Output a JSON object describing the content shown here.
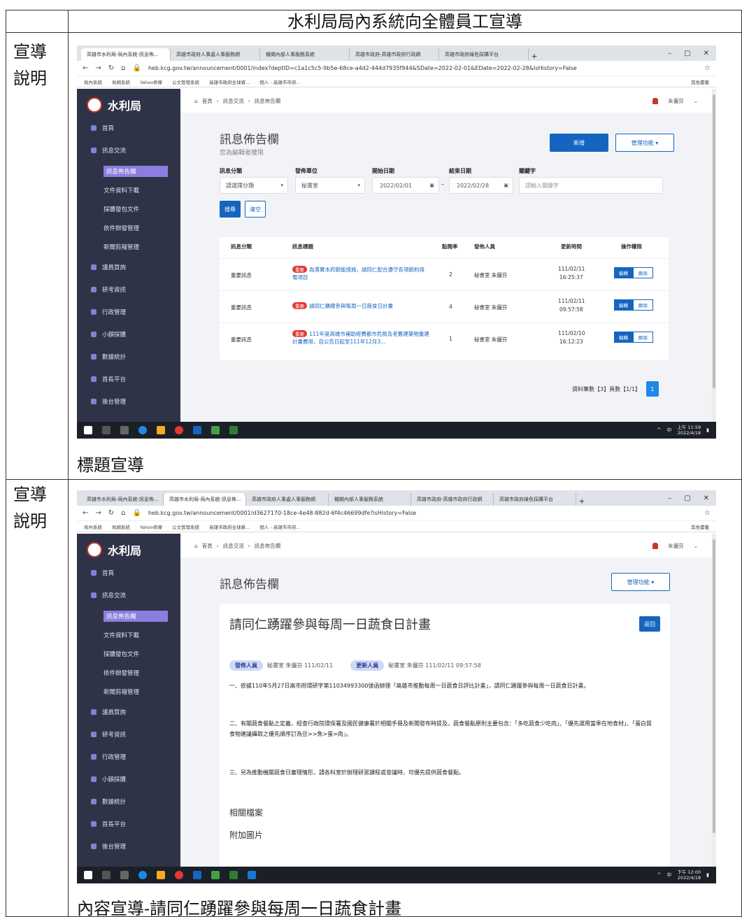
{
  "document": {
    "title": "水利局局內系統向全體員工宣導",
    "row_label": "宣導說明",
    "caption_1": "標題宣導",
    "caption_2": "內容宣導-請同仁踴躍參與每周一日蔬食計畫"
  },
  "browser_1": {
    "tabs": [
      "高雄市水利局-局內系統-訊息佈...",
      "高雄市政府人事處人事服務網",
      "機關內部人事服務系統",
      "高雄市政府-高雄市政府行政網",
      "高雄市政府綠色採購平台"
    ],
    "url": "heb.kcg.gov.tw/announcement/0001/index?deptID=c1a1c5c5-9b5e-68ce-a4d2-444d7935f944&SDate=2022-02-01&EDate=2022-02-28&IsHistory=False",
    "bookmarks": [
      "局內系統",
      "局網系統",
      "Yahoo奇摩",
      "公文管理系統",
      "高雄市政府全球資...",
      "個人 - 高雄市市府..."
    ],
    "bookmarks_right": "其他書籤"
  },
  "browser_2": {
    "tabs": [
      "高雄市水利局-局內系統-訊息佈...",
      "高雄市水利局-局內系統-訊息佈...",
      "高雄市政府人事處人事服務網",
      "機關內部人事服務系統",
      "高雄市政府-高雄市政府行政網",
      "高雄市政府綠色採購平台"
    ],
    "url": "heb.kcg.gov.tw/announcement/0001/d3627170-18ce-4e48-882d-6f4c46699dfe?isHistory=False"
  },
  "app": {
    "logo_text": "水利局",
    "breadcrumb": [
      "首頁",
      "訊息交流",
      "訊息佈告欄"
    ],
    "user": "朱儷芬",
    "nav": [
      {
        "label": "首頁",
        "sub": false
      },
      {
        "label": "訊息交流",
        "sub": false
      },
      {
        "label": "訊息佈告欄",
        "sub": true,
        "active": true
      },
      {
        "label": "文件資料下載",
        "sub": true
      },
      {
        "label": "採購發包文件",
        "sub": true
      },
      {
        "label": "依件辦發管理",
        "sub": true
      },
      {
        "label": "新聞剪報管理",
        "sub": true
      },
      {
        "label": "議員質詢",
        "sub": false
      },
      {
        "label": "研考資訊",
        "sub": false
      },
      {
        "label": "行政管理",
        "sub": false
      },
      {
        "label": "小額採購",
        "sub": false
      },
      {
        "label": "數據統計",
        "sub": false
      },
      {
        "label": "首長平台",
        "sub": false
      },
      {
        "label": "後台管理",
        "sub": false
      }
    ]
  },
  "list_page": {
    "heading": "訊息佈告欄",
    "subheading": "您為編輯者權限",
    "new_btn": "新增",
    "manage_btn": "管理功能 ▾",
    "filters": {
      "category_label": "訊息分類",
      "category_value": "請選擇分類",
      "unit_label": "發佈單位",
      "unit_value": "秘書室",
      "start_label": "開始日期",
      "start_value": "2022/02/01",
      "end_label": "結束日期",
      "end_value": "2022/02/28",
      "keyword_label": "關鍵字",
      "keyword_placeholder": "請輸入關鍵字"
    },
    "search_btn": "搜尋",
    "clear_btn": "清空",
    "columns": [
      "訊息分類",
      "訊息標題",
      "點閱率",
      "發佈人員",
      "更新時間",
      "操作權限"
    ],
    "rows": [
      {
        "category": "重要訊息",
        "tag": "重要",
        "title": "為落實本府節能措施，請同仁配合遵守各項節約用電項目",
        "clicks": "2",
        "publisher": "秘書室 朱儷芬",
        "date": "111/02/11",
        "time": "16:25:37"
      },
      {
        "category": "重要訊息",
        "tag": "重要",
        "title": "請同仁踴躍參與每周一日蔬食日計畫",
        "clicks": "4",
        "publisher": "秘書室 朱儷芬",
        "date": "111/02/11",
        "time": "09:57:58"
      },
      {
        "category": "重要訊息",
        "tag": "重要",
        "title": "111年度高雄市補助經費都市危險及老舊建築物重建計畫費用，自公告日起至111年12月3...",
        "clicks": "1",
        "publisher": "秘書室 朱儷芬",
        "date": "111/02/10",
        "time": "16:12:23"
      }
    ],
    "edit_btn": "編輯",
    "delete_btn": "刪除",
    "pager_text": "資料筆數【3】頁數【1/1】",
    "page": "1"
  },
  "detail_page": {
    "heading": "訊息佈告欄",
    "manage_btn": "管理功能 ▾",
    "title": "請同仁踴躍參與每周一日蔬食日計畫",
    "back_btn": "返回",
    "publisher_pill": "發佈人員",
    "publisher_text": "秘書室 朱儷芬 111/02/11",
    "updater_pill": "更新人員",
    "updater_text": "秘書室 朱儷芬 111/02/11 09:57:58",
    "para1": "一、依據110年5月27日高市府環研字第11034993300號函辦理「高雄市推動每周一日蔬食日評比計畫」，請同仁踴躍參與每周一日蔬食日計畫。",
    "para2": "二、有關蔬食餐點之定義，經查行政院環保署及國民健康署於相關手冊及新聞發布時提及，蔬食餐點原則主要包含：「多吃蔬食少吃肉」、「優先選用當季在地食材」、「蛋白質食物建議攝取之優先順序訂為豆>>魚>蛋>肉」。",
    "para3": "三、另為推動機關蔬食日審理情形，請各科室於辦理研習課程或會議時，可優先提供蔬食餐點。",
    "related_files": "相關檔案",
    "attached_images": "附加圖片"
  },
  "taskbar_1": {
    "time": "上午 11:59",
    "date": "2022/4/18",
    "ime": "中"
  },
  "taskbar_2": {
    "time": "下午 12:00",
    "date": "2022/4/18",
    "ime": "中"
  },
  "colors": {
    "sidebar": "#2e3347",
    "primary": "#1565c0",
    "tag_red": "#e53935",
    "taskbar": "#1b1f27"
  }
}
